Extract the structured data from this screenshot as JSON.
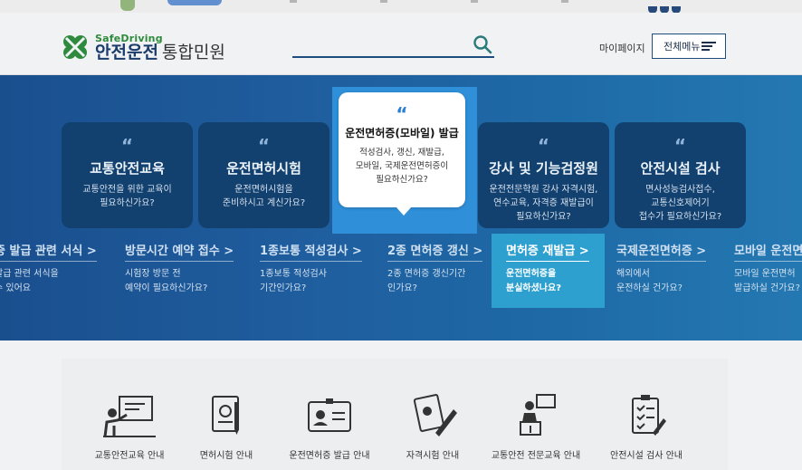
{
  "header": {
    "logo_sub": "SafeDriving",
    "logo_main": "안전운전",
    "logo_main_light": "통합민원",
    "mypage": "마이페이지",
    "menu_button": "전체메뉴"
  },
  "cards": [
    {
      "quote": "“",
      "title": "교통안전교육",
      "desc1": "교통안전을 위한 교육이",
      "desc2": "필요하신가요?"
    },
    {
      "quote": "“",
      "title": "운전면허시험",
      "desc1": "운전면허시험을",
      "desc2": "준비하시고 계신가요?"
    },
    {
      "quote": "“",
      "title": "강사 및 기능검정원",
      "desc1": "운전전문학원 강사 자격시험,",
      "desc2": "연수교육, 자격증 재발급이",
      "desc3": "필요하신가요?"
    },
    {
      "quote": "“",
      "title": "안전시설 검사",
      "desc1": "면사성능검사접수,",
      "desc2": "교통신호제어기",
      "desc3": "접수가 필요하신가요?"
    }
  ],
  "highlight_card": {
    "quote": "“",
    "title": "운전면허증(모바일) 발급",
    "desc1": "적성검사, 갱신, 재발급,",
    "desc2": "모바일, 국제운전면허증이",
    "desc3": "필요하신가요?"
  },
  "links": [
    {
      "title": "증 발급 관련 서식 >",
      "desc1": "발급 관련 서식을",
      "desc2": "수 있어요"
    },
    {
      "title": "방문시간 예약 접수 >",
      "desc1": "시험장 방문 전",
      "desc2": "예약이 필요하신가요?"
    },
    {
      "title": "1종보통 적성검사 >",
      "desc1": "1종보통 적성검사",
      "desc2": "기간인가요?"
    },
    {
      "title": "2종 면허증 갱신 >",
      "desc1": "2종 면허증 갱신기간",
      "desc2": "인가요?"
    },
    {
      "title": "면허증 재발급 >",
      "desc1": "운전면허증을",
      "desc2": "분실하셨나요?"
    },
    {
      "title": "국제운전면허증 >",
      "desc1": "해외에서",
      "desc2": "운전하실 건가요?"
    },
    {
      "title": "모바일 운전면",
      "desc1": "모바일 운전면허",
      "desc2": "발급하실 건가요?"
    }
  ],
  "services": [
    {
      "label": "교통안전교육 안내",
      "icon": "teacher-board-icon"
    },
    {
      "label": "면허시험 안내",
      "icon": "exam-document-icon"
    },
    {
      "label": "운전면허증 발급 안내",
      "icon": "license-card-icon"
    },
    {
      "label": "자격시험 안내",
      "icon": "qualification-pen-icon"
    },
    {
      "label": "교통안전 전문교육 안내",
      "icon": "lecture-podium-icon"
    },
    {
      "label": "안전시설 검사 안내",
      "icon": "checklist-icon"
    }
  ]
}
